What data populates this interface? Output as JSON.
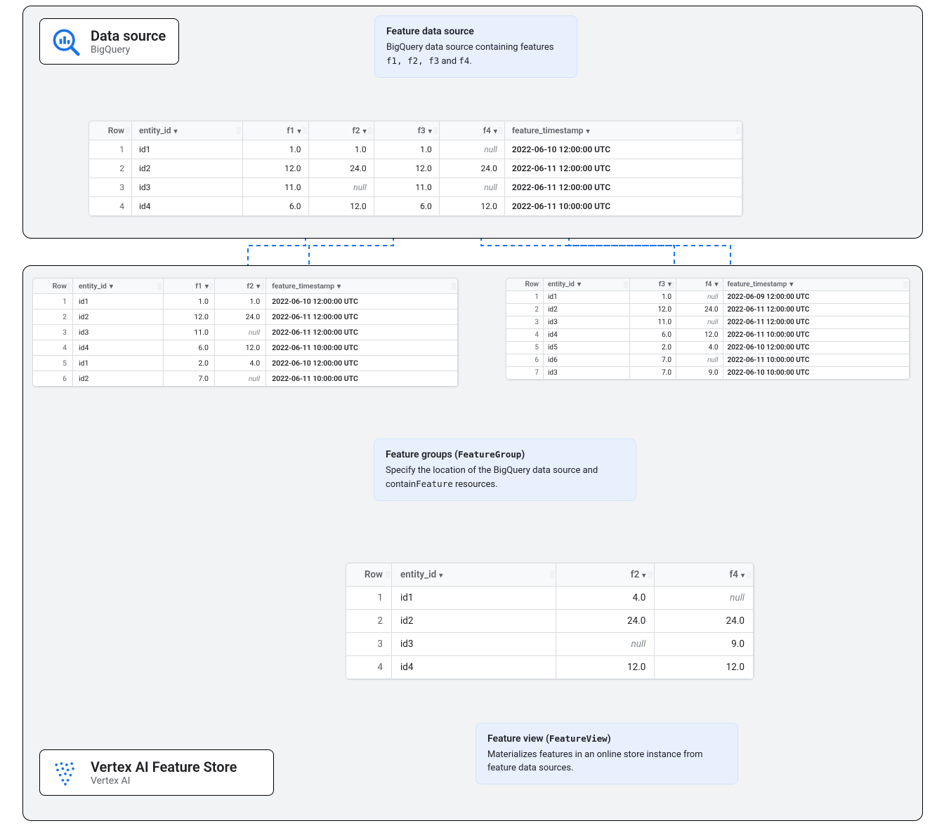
{
  "cards": {
    "source": {
      "title": "Data source",
      "subtitle": "BigQuery"
    },
    "store": {
      "title": "Vertex AI Feature Store",
      "subtitle": "Vertex AI"
    }
  },
  "callouts": {
    "source": {
      "title": "Feature data source",
      "body_pre": "BigQuery data source containing features ",
      "body_features": "f1, f2, f3",
      "body_mid": " and ",
      "body_last": "f4",
      "body_post": "."
    },
    "groups": {
      "title_pre": "Feature groups (",
      "title_code": "FeatureGroup",
      "title_post": ")",
      "body_pre": "Specify the location of the BigQuery data source and contain",
      "body_code": "Feature",
      "body_post": " resources."
    },
    "view": {
      "title_pre": "Feature view (",
      "title_code": "FeatureView",
      "title_post": ")",
      "body": "Materializes features in an online store instance from feature data sources."
    }
  },
  "headers": {
    "row": "Row",
    "entity": "entity_id",
    "f1": "f1",
    "f2": "f2",
    "f3": "f3",
    "f4": "f4",
    "ts": "feature_timestamp"
  },
  "null_label": "null",
  "tables": {
    "t1": {
      "cols": [
        "row",
        "entity",
        "f1",
        "f2",
        "f3",
        "f4",
        "ts"
      ],
      "rows": [
        {
          "row": "1",
          "entity": "id1",
          "f1": "1.0",
          "f2": "1.0",
          "f3": "1.0",
          "f4": null,
          "ts": "2022-06-10 12:00:00 UTC"
        },
        {
          "row": "2",
          "entity": "id2",
          "f1": "12.0",
          "f2": "24.0",
          "f3": "12.0",
          "f4": "24.0",
          "ts": "2022-06-11 12:00:00 UTC"
        },
        {
          "row": "3",
          "entity": "id3",
          "f1": "11.0",
          "f2": null,
          "f3": "11.0",
          "f4": null,
          "ts": "2022-06-11 12:00:00 UTC"
        },
        {
          "row": "4",
          "entity": "id4",
          "f1": "6.0",
          "f2": "12.0",
          "f3": "6.0",
          "f4": "12.0",
          "ts": "2022-06-11 10:00:00 UTC"
        }
      ]
    },
    "t2": {
      "cols": [
        "row",
        "entity",
        "f1",
        "f2",
        "ts"
      ],
      "rows": [
        {
          "row": "1",
          "entity": "id1",
          "f1": "1.0",
          "f2": "1.0",
          "ts": "2022-06-10 12:00:00 UTC"
        },
        {
          "row": "2",
          "entity": "id2",
          "f1": "12.0",
          "f2": "24.0",
          "ts": "2022-06-11 12:00:00 UTC"
        },
        {
          "row": "3",
          "entity": "id3",
          "f1": "11.0",
          "f2": null,
          "ts": "2022-06-11 12:00:00 UTC"
        },
        {
          "row": "4",
          "entity": "id4",
          "f1": "6.0",
          "f2": "12.0",
          "ts": "2022-06-11 10:00:00 UTC"
        },
        {
          "row": "5",
          "entity": "id1",
          "f1": "2.0",
          "f2": "4.0",
          "ts": "2022-06-10 12:00:00 UTC"
        },
        {
          "row": "6",
          "entity": "id2",
          "f1": "7.0",
          "f2": null,
          "ts": "2022-06-11 10:00:00 UTC"
        }
      ]
    },
    "t3": {
      "cols": [
        "row",
        "entity",
        "f3",
        "f4",
        "ts"
      ],
      "rows": [
        {
          "row": "1",
          "entity": "id1",
          "f3": "1.0",
          "f4": null,
          "ts": "2022-06-09 12:00:00 UTC"
        },
        {
          "row": "2",
          "entity": "id2",
          "f3": "12.0",
          "f4": "24.0",
          "ts": "2022-06-11 12:00:00 UTC"
        },
        {
          "row": "3",
          "entity": "id3",
          "f3": "11.0",
          "f4": null,
          "ts": "2022-06-11 12:00:00 UTC"
        },
        {
          "row": "4",
          "entity": "id4",
          "f3": "6.0",
          "f4": "12.0",
          "ts": "2022-06-11 10:00:00 UTC"
        },
        {
          "row": "5",
          "entity": "id5",
          "f3": "2.0",
          "f4": "4.0",
          "ts": "2022-06-10 12:00:00 UTC"
        },
        {
          "row": "6",
          "entity": "id6",
          "f3": "7.0",
          "f4": null,
          "ts": "2022-06-11 10:00:00 UTC"
        },
        {
          "row": "7",
          "entity": "id3",
          "f3": "7.0",
          "f4": "9.0",
          "ts": "2022-06-10 10:00:00 UTC"
        }
      ]
    },
    "t4": {
      "cols": [
        "row",
        "entity",
        "f2",
        "f4"
      ],
      "rows": [
        {
          "row": "1",
          "entity": "id1",
          "f2": "4.0",
          "f4": null
        },
        {
          "row": "2",
          "entity": "id2",
          "f2": "24.0",
          "f4": "24.0"
        },
        {
          "row": "3",
          "entity": "id3",
          "f2": null,
          "f4": "9.0"
        },
        {
          "row": "4",
          "entity": "id4",
          "f2": "12.0",
          "f4": "12.0"
        }
      ]
    }
  }
}
